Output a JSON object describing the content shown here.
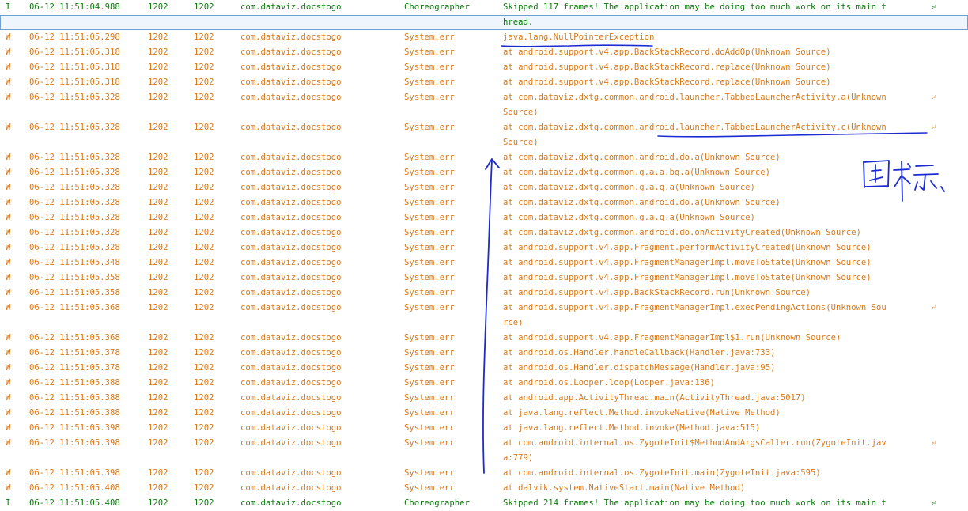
{
  "wrap_glyph": "⏎",
  "colors": {
    "info": "#0b7a0b",
    "warn": "#d9791a",
    "annotation": "#1c2bd1",
    "selection": "#6f9fd0"
  },
  "rows": [
    {
      "level": "I",
      "time": "06-12 11:51:04.988",
      "pid": "1202",
      "tid": "1202",
      "app": "com.dataviz.docstogo",
      "tag": "Choreographer",
      "text": "Skipped 117 frames!  The application may be doing too much work on its main t",
      "wrap": true
    },
    {
      "level": "I",
      "time": "",
      "pid": "",
      "tid": "",
      "app": "",
      "tag": "",
      "text": "hread.",
      "wrap": false,
      "cont": true,
      "selected": true
    },
    {
      "level": "W",
      "time": "06-12 11:51:05.298",
      "pid": "1202",
      "tid": "1202",
      "app": "com.dataviz.docstogo",
      "tag": "System.err",
      "text": "java.lang.NullPointerException",
      "wrap": false
    },
    {
      "level": "W",
      "time": "06-12 11:51:05.318",
      "pid": "1202",
      "tid": "1202",
      "app": "com.dataviz.docstogo",
      "tag": "System.err",
      "text": "at android.support.v4.app.BackStackRecord.doAddOp(Unknown Source)",
      "wrap": false
    },
    {
      "level": "W",
      "time": "06-12 11:51:05.318",
      "pid": "1202",
      "tid": "1202",
      "app": "com.dataviz.docstogo",
      "tag": "System.err",
      "text": "at android.support.v4.app.BackStackRecord.replace(Unknown Source)",
      "wrap": false
    },
    {
      "level": "W",
      "time": "06-12 11:51:05.318",
      "pid": "1202",
      "tid": "1202",
      "app": "com.dataviz.docstogo",
      "tag": "System.err",
      "text": "at android.support.v4.app.BackStackRecord.replace(Unknown Source)",
      "wrap": false
    },
    {
      "level": "W",
      "time": "06-12 11:51:05.328",
      "pid": "1202",
      "tid": "1202",
      "app": "com.dataviz.docstogo",
      "tag": "System.err",
      "text": "at com.dataviz.dxtg.common.android.launcher.TabbedLauncherActivity.a(Unknown",
      "wrap": true
    },
    {
      "level": "W",
      "time": "",
      "pid": "",
      "tid": "",
      "app": "",
      "tag": "",
      "text": " Source)",
      "wrap": false,
      "cont": true
    },
    {
      "level": "W",
      "time": "06-12 11:51:05.328",
      "pid": "1202",
      "tid": "1202",
      "app": "com.dataviz.docstogo",
      "tag": "System.err",
      "text": "at com.dataviz.dxtg.common.android.launcher.TabbedLauncherActivity.c(Unknown",
      "wrap": true
    },
    {
      "level": "W",
      "time": "",
      "pid": "",
      "tid": "",
      "app": "",
      "tag": "",
      "text": " Source)",
      "wrap": false,
      "cont": true
    },
    {
      "level": "W",
      "time": "06-12 11:51:05.328",
      "pid": "1202",
      "tid": "1202",
      "app": "com.dataviz.docstogo",
      "tag": "System.err",
      "text": "at com.dataviz.dxtg.common.android.do.a(Unknown Source)",
      "wrap": false
    },
    {
      "level": "W",
      "time": "06-12 11:51:05.328",
      "pid": "1202",
      "tid": "1202",
      "app": "com.dataviz.docstogo",
      "tag": "System.err",
      "text": "at com.dataviz.dxtg.common.g.a.a.bg.a(Unknown Source)",
      "wrap": false
    },
    {
      "level": "W",
      "time": "06-12 11:51:05.328",
      "pid": "1202",
      "tid": "1202",
      "app": "com.dataviz.docstogo",
      "tag": "System.err",
      "text": "at com.dataviz.dxtg.common.g.a.q.a(Unknown Source)",
      "wrap": false
    },
    {
      "level": "W",
      "time": "06-12 11:51:05.328",
      "pid": "1202",
      "tid": "1202",
      "app": "com.dataviz.docstogo",
      "tag": "System.err",
      "text": "at com.dataviz.dxtg.common.android.do.a(Unknown Source)",
      "wrap": false
    },
    {
      "level": "W",
      "time": "06-12 11:51:05.328",
      "pid": "1202",
      "tid": "1202",
      "app": "com.dataviz.docstogo",
      "tag": "System.err",
      "text": "at com.dataviz.dxtg.common.g.a.q.a(Unknown Source)",
      "wrap": false
    },
    {
      "level": "W",
      "time": "06-12 11:51:05.328",
      "pid": "1202",
      "tid": "1202",
      "app": "com.dataviz.docstogo",
      "tag": "System.err",
      "text": "at com.dataviz.dxtg.common.android.do.onActivityCreated(Unknown Source)",
      "wrap": false
    },
    {
      "level": "W",
      "time": "06-12 11:51:05.328",
      "pid": "1202",
      "tid": "1202",
      "app": "com.dataviz.docstogo",
      "tag": "System.err",
      "text": "at android.support.v4.app.Fragment.performActivityCreated(Unknown Source)",
      "wrap": false
    },
    {
      "level": "W",
      "time": "06-12 11:51:05.348",
      "pid": "1202",
      "tid": "1202",
      "app": "com.dataviz.docstogo",
      "tag": "System.err",
      "text": "at android.support.v4.app.FragmentManagerImpl.moveToState(Unknown Source)",
      "wrap": false
    },
    {
      "level": "W",
      "time": "06-12 11:51:05.358",
      "pid": "1202",
      "tid": "1202",
      "app": "com.dataviz.docstogo",
      "tag": "System.err",
      "text": "at android.support.v4.app.FragmentManagerImpl.moveToState(Unknown Source)",
      "wrap": false
    },
    {
      "level": "W",
      "time": "06-12 11:51:05.358",
      "pid": "1202",
      "tid": "1202",
      "app": "com.dataviz.docstogo",
      "tag": "System.err",
      "text": "at android.support.v4.app.BackStackRecord.run(Unknown Source)",
      "wrap": false
    },
    {
      "level": "W",
      "time": "06-12 11:51:05.368",
      "pid": "1202",
      "tid": "1202",
      "app": "com.dataviz.docstogo",
      "tag": "System.err",
      "text": "at android.support.v4.app.FragmentManagerImpl.execPendingActions(Unknown Sou",
      "wrap": true
    },
    {
      "level": "W",
      "time": "",
      "pid": "",
      "tid": "",
      "app": "",
      "tag": "",
      "text": "rce)",
      "wrap": false,
      "cont": true
    },
    {
      "level": "W",
      "time": "06-12 11:51:05.368",
      "pid": "1202",
      "tid": "1202",
      "app": "com.dataviz.docstogo",
      "tag": "System.err",
      "text": "at android.support.v4.app.FragmentManagerImpl$1.run(Unknown Source)",
      "wrap": false
    },
    {
      "level": "W",
      "time": "06-12 11:51:05.378",
      "pid": "1202",
      "tid": "1202",
      "app": "com.dataviz.docstogo",
      "tag": "System.err",
      "text": "at android.os.Handler.handleCallback(Handler.java:733)",
      "wrap": false
    },
    {
      "level": "W",
      "time": "06-12 11:51:05.378",
      "pid": "1202",
      "tid": "1202",
      "app": "com.dataviz.docstogo",
      "tag": "System.err",
      "text": "at android.os.Handler.dispatchMessage(Handler.java:95)",
      "wrap": false
    },
    {
      "level": "W",
      "time": "06-12 11:51:05.388",
      "pid": "1202",
      "tid": "1202",
      "app": "com.dataviz.docstogo",
      "tag": "System.err",
      "text": "at android.os.Looper.loop(Looper.java:136)",
      "wrap": false
    },
    {
      "level": "W",
      "time": "06-12 11:51:05.388",
      "pid": "1202",
      "tid": "1202",
      "app": "com.dataviz.docstogo",
      "tag": "System.err",
      "text": "at android.app.ActivityThread.main(ActivityThread.java:5017)",
      "wrap": false
    },
    {
      "level": "W",
      "time": "06-12 11:51:05.388",
      "pid": "1202",
      "tid": "1202",
      "app": "com.dataviz.docstogo",
      "tag": "System.err",
      "text": "at java.lang.reflect.Method.invokeNative(Native Method)",
      "wrap": false
    },
    {
      "level": "W",
      "time": "06-12 11:51:05.398",
      "pid": "1202",
      "tid": "1202",
      "app": "com.dataviz.docstogo",
      "tag": "System.err",
      "text": "at java.lang.reflect.Method.invoke(Method.java:515)",
      "wrap": false
    },
    {
      "level": "W",
      "time": "06-12 11:51:05.398",
      "pid": "1202",
      "tid": "1202",
      "app": "com.dataviz.docstogo",
      "tag": "System.err",
      "text": "at com.android.internal.os.ZygoteInit$MethodAndArgsCaller.run(ZygoteInit.jav",
      "wrap": true
    },
    {
      "level": "W",
      "time": "",
      "pid": "",
      "tid": "",
      "app": "",
      "tag": "",
      "text": "a:779)",
      "wrap": false,
      "cont": true
    },
    {
      "level": "W",
      "time": "06-12 11:51:05.398",
      "pid": "1202",
      "tid": "1202",
      "app": "com.dataviz.docstogo",
      "tag": "System.err",
      "text": "at com.android.internal.os.ZygoteInit.main(ZygoteInit.java:595)",
      "wrap": false
    },
    {
      "level": "W",
      "time": "06-12 11:51:05.408",
      "pid": "1202",
      "tid": "1202",
      "app": "com.dataviz.docstogo",
      "tag": "System.err",
      "text": "at dalvik.system.NativeStart.main(Native Method)",
      "wrap": false
    },
    {
      "level": "I",
      "time": "06-12 11:51:05.408",
      "pid": "1202",
      "tid": "1202",
      "app": "com.dataviz.docstogo",
      "tag": "Choreographer",
      "text": "Skipped 214 frames!  The application may be doing too much work on its main t",
      "wrap": true
    }
  ]
}
